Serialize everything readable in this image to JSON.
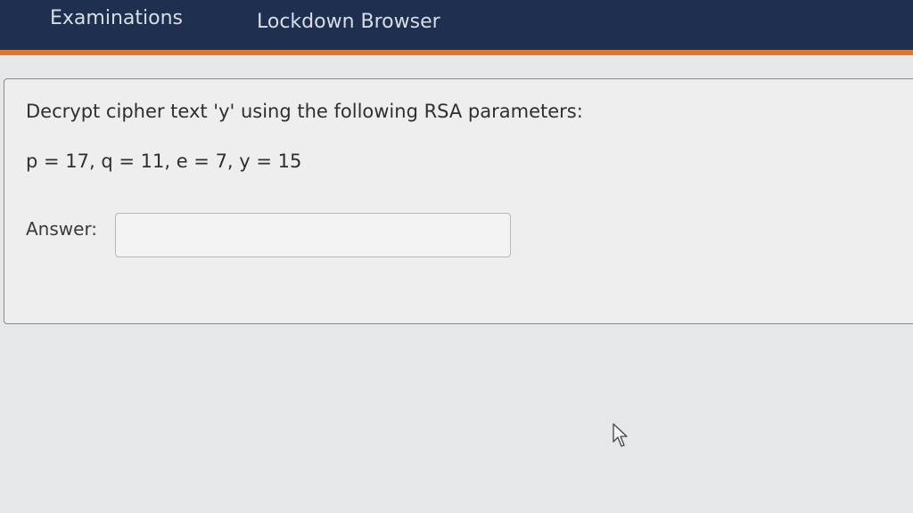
{
  "header": {
    "tabs": [
      {
        "label": "Examinations"
      },
      {
        "label": "Lockdown Browser"
      }
    ]
  },
  "question": {
    "prompt": "Decrypt cipher text 'y' using the following RSA parameters:",
    "parameters": "p = 17, q = 11, e = 7, y = 15",
    "answer_label": "Answer:",
    "answer_value": ""
  },
  "colors": {
    "header_bg": "#1f2f4f",
    "accent": "#e0762f",
    "page_bg": "#e6e7e9"
  },
  "icons": {
    "pointer": "mouse-pointer-icon"
  }
}
